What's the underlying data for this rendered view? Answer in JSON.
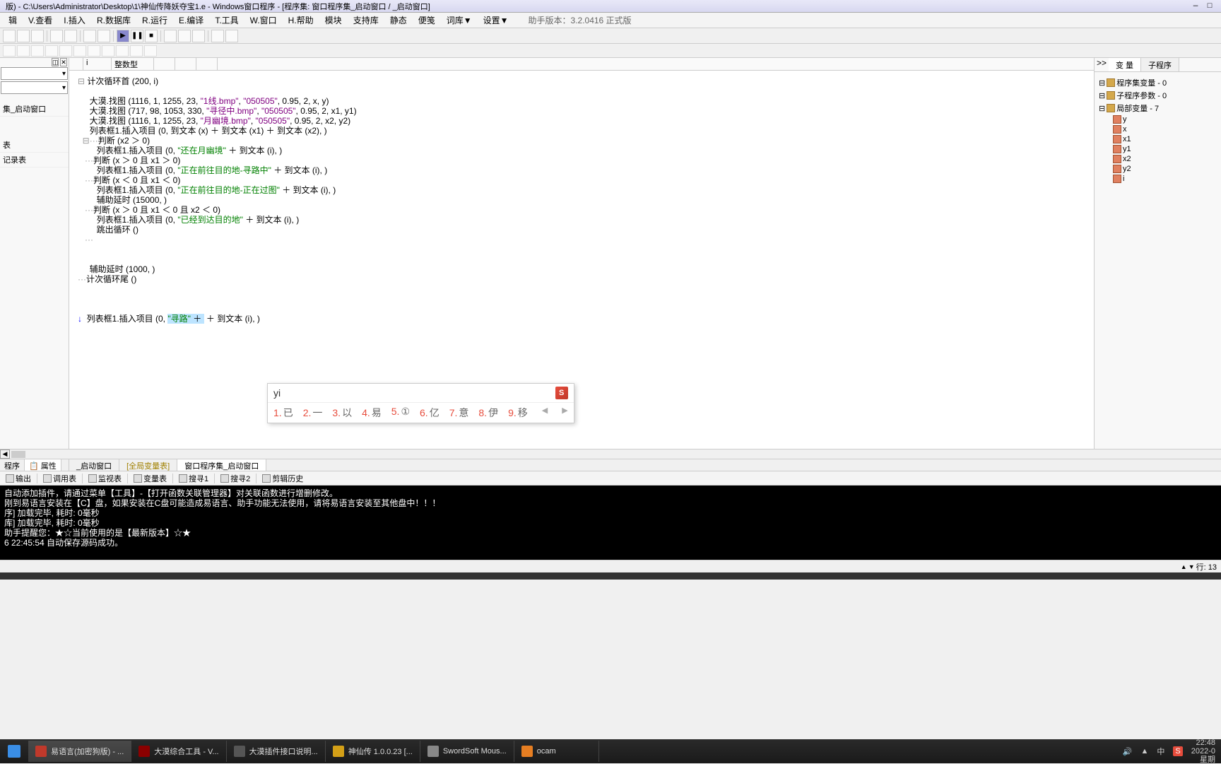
{
  "titlebar": {
    "text": "版) - C:\\Users\\Administrator\\Desktop\\1\\神仙传降妖夺宝1.e - Windows窗口程序 - [程序集: 窗口程序集_启动窗口 / _启动窗口]",
    "min": "—",
    "max": "□"
  },
  "menu": {
    "items": [
      "辑",
      "V.查看",
      "I.插入",
      "R.数据库",
      "R.运行",
      "E.编译",
      "T.工具",
      "W.窗口",
      "H.帮助",
      "模块",
      "支持库",
      "静态",
      "便笺",
      "词库▼",
      "设置▼"
    ],
    "version": "助手版本：3.2.0416 正式版"
  },
  "left": {
    "tree_items": [
      "集_启动窗口",
      "表",
      "记录表"
    ],
    "bottom_tabs": {
      "t1": "程序",
      "t2": "属性"
    }
  },
  "vartable": {
    "c1": "i",
    "c2": "整数型"
  },
  "code": {
    "l1": "计次循环首 (200, i)",
    "l2a": "大漠.找图 (1116, 1, 1255, 23, ",
    "l2b": "\"1线.bmp\"",
    "l2c": ", ",
    "l2d": "\"050505\"",
    "l2e": ", 0.95, 2, x, y)",
    "l3a": "大漠.找图 (717, 98, 1053, 330, ",
    "l3b": "\"寻径中.bmp\"",
    "l3c": ", ",
    "l3d": "\"050505\"",
    "l3e": ", 0.95, 2, x1, y1)",
    "l4a": "大漠.找图 (1116, 1, 1255, 23, ",
    "l4b": "\"月幽境.bmp\"",
    "l4c": ", ",
    "l4d": "\"050505\"",
    "l4e": ", 0.95, 2, x2, y2)",
    "l5": "列表框1.插入项目 (0, 到文本 (x) ＋ 到文本 (x1) ＋ 到文本 (x2), )",
    "l6": "判断 (x2 ＞ 0)",
    "l7a": "列表框1.插入项目 (0, ",
    "l7b": "\"还在月幽境\"",
    "l7c": " ＋ 到文本 (i), )",
    "l8": "判断 (x ＞ 0 且 x1 ＞ 0)",
    "l9a": "列表框1.插入项目 (0, ",
    "l9b": "\"正在前往目的地-寻路中\"",
    "l9c": " ＋ 到文本 (i), )",
    "l10": "判断 (x ＜ 0 且 x1 ＜ 0)",
    "l11a": "列表框1.插入项目 (0, ",
    "l11b": "\"正在前往目的地-正在过图\"",
    "l11c": " ＋ 到文本 (i), )",
    "l12": "辅助延时 (15000, )",
    "l13": "判断 (x ＞ 0 且 x1 ＜ 0 且 x2 ＜ 0)",
    "l14a": "列表框1.插入项目 (0, ",
    "l14b": "\"已经到达目的地\"",
    "l14c": " ＋ 到文本 (i), )",
    "l15": "跳出循环 ()",
    "l16": "辅助延时 (1000, )",
    "l17": "计次循环尾 ()",
    "l18a": "列表框1.插入项目 (0, ",
    "l18b": "\"寻路\"",
    "l18c": " ＋ 到文本 (i), )"
  },
  "ime": {
    "input": "yi",
    "logo": "S",
    "candidates": [
      {
        "n": "1.",
        "t": "已"
      },
      {
        "n": "2.",
        "t": "一"
      },
      {
        "n": "3.",
        "t": "以"
      },
      {
        "n": "4.",
        "t": "易"
      },
      {
        "n": "5.",
        "t": "①"
      },
      {
        "n": "6.",
        "t": "亿"
      },
      {
        "n": "7.",
        "t": "意"
      },
      {
        "n": "8.",
        "t": "伊"
      },
      {
        "n": "9.",
        "t": "移"
      }
    ]
  },
  "right": {
    "tab_expand": ">>",
    "tab1": "变 量",
    "tab2": "子程序",
    "tree": {
      "n1": "程序集变量 - 0",
      "n2": "子程序参数 - 0",
      "n3": "局部变量 - 7",
      "children": [
        "y",
        "x",
        "x1",
        "y1",
        "x2",
        "y2",
        "i"
      ]
    }
  },
  "doc_tabs": {
    "t1": "_启动窗口",
    "t2": "[全局变量表]",
    "t3": "窗口程序集_启动窗口"
  },
  "bottom_toolbar": [
    "输出",
    "调用表",
    "监视表",
    "变量表",
    "搜寻1",
    "搜寻2",
    "剪辑历史"
  ],
  "console": {
    "l1": "自动添加插件，请通过菜单【工具】-【打开函数关联管理器】对关联函数进行增删修改。",
    "l2": "刚到易语言安装在【C】盘，如果安装在C盘可能造成易语言、助手功能无法使用，请将易语言安装至其他盘中！！！",
    "l3": "序] 加载完毕, 耗时: 0毫秒",
    "l4": "库] 加载完毕, 耗时: 0毫秒",
    "l5": "",
    "l6": "助手提醒您：★☆当前使用的是【最新版本】☆★",
    "l7": "6 22:45:54 自动保存源码成功。"
  },
  "status": {
    "pos": "行: 13"
  },
  "taskbar": {
    "tasks": [
      {
        "label": "易语言(加密狗版) - ...",
        "color": "#c0392b"
      },
      {
        "label": "大漠综合工具 - V...",
        "color": "#8b0000"
      },
      {
        "label": "大漠插件接口说明...",
        "color": "#555"
      },
      {
        "label": "神仙传 1.0.0.23 [...",
        "color": "#d4a017"
      },
      {
        "label": "SwordSoft Mous...",
        "color": "#888"
      },
      {
        "label": "ocam",
        "color": "#e67e22"
      }
    ],
    "tray": {
      "ime": "中",
      "sogou": "S",
      "time": "22:48",
      "date": "2022-0",
      "day": "星期"
    }
  }
}
